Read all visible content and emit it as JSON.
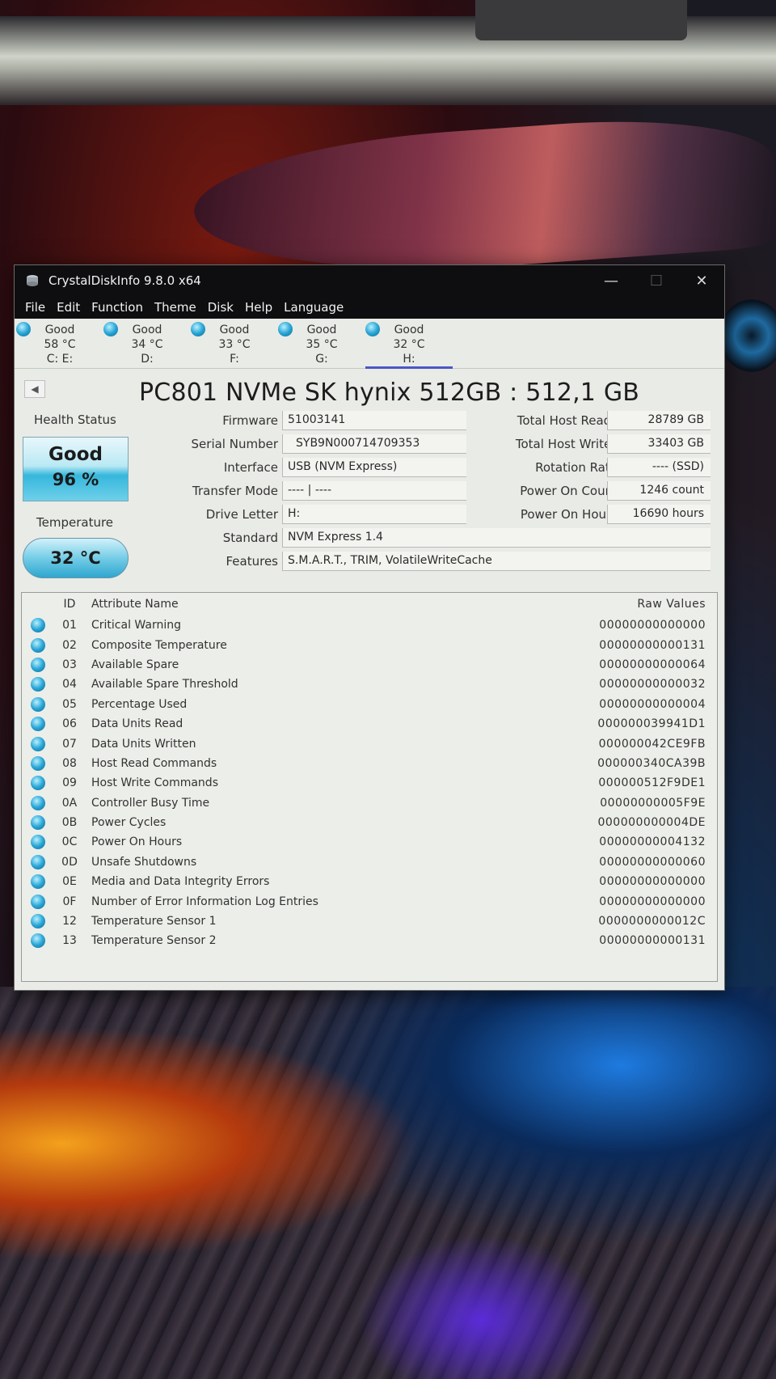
{
  "window": {
    "title": "CrystalDiskInfo 9.8.0 x64",
    "minimize": "—",
    "maximize": "☐",
    "close": "✕"
  },
  "menu": [
    "File",
    "Edit",
    "Function",
    "Theme",
    "Disk",
    "Help",
    "Language"
  ],
  "drives": [
    {
      "status": "Good",
      "temp": "58 °C",
      "letter": "C: E:"
    },
    {
      "status": "Good",
      "temp": "34 °C",
      "letter": "D:"
    },
    {
      "status": "Good",
      "temp": "33 °C",
      "letter": "F:"
    },
    {
      "status": "Good",
      "temp": "35 °C",
      "letter": "G:"
    },
    {
      "status": "Good",
      "temp": "32 °C",
      "letter": "H:"
    }
  ],
  "disk": {
    "title": "PC801 NVMe SK hynix 512GB : 512,1 GB",
    "prev_arrow": "◀"
  },
  "health": {
    "label": "Health Status",
    "status": "Good",
    "percent": "96 %",
    "temp_label": "Temperature",
    "temp": "32 °C"
  },
  "fields": {
    "firmware_label": "Firmware",
    "firmware": "51003141",
    "serial_label": "Serial Number",
    "serial": "SYB9N000714709353",
    "interface_label": "Interface",
    "interface": "USB (NVM Express)",
    "transfer_label": "Transfer Mode",
    "transfer": "---- | ----",
    "letter_label": "Drive Letter",
    "letter": "H:",
    "standard_label": "Standard",
    "standard": "NVM Express 1.4",
    "features_label": "Features",
    "features": "S.M.A.R.T., TRIM, VolatileWriteCache",
    "reads_label": "Total Host Reads",
    "reads": "28789 GB",
    "writes_label": "Total Host Writes",
    "writes": "33403 GB",
    "rotation_label": "Rotation Rate",
    "rotation": "---- (SSD)",
    "count_label": "Power On Count",
    "count": "1246 count",
    "hours_label": "Power On Hours",
    "hours": "16690 hours"
  },
  "smart": {
    "headers": {
      "id": "ID",
      "name": "Attribute Name",
      "raw": "Raw Values"
    },
    "rows": [
      {
        "id": "01",
        "name": "Critical Warning",
        "raw": "00000000000000"
      },
      {
        "id": "02",
        "name": "Composite Temperature",
        "raw": "00000000000131"
      },
      {
        "id": "03",
        "name": "Available Spare",
        "raw": "00000000000064"
      },
      {
        "id": "04",
        "name": "Available Spare Threshold",
        "raw": "00000000000032"
      },
      {
        "id": "05",
        "name": "Percentage Used",
        "raw": "00000000000004"
      },
      {
        "id": "06",
        "name": "Data Units Read",
        "raw": "000000039941D1"
      },
      {
        "id": "07",
        "name": "Data Units Written",
        "raw": "000000042CE9FB"
      },
      {
        "id": "08",
        "name": "Host Read Commands",
        "raw": "000000340CA39B"
      },
      {
        "id": "09",
        "name": "Host Write Commands",
        "raw": "000000512F9DE1"
      },
      {
        "id": "0A",
        "name": "Controller Busy Time",
        "raw": "00000000005F9E"
      },
      {
        "id": "0B",
        "name": "Power Cycles",
        "raw": "000000000004DE"
      },
      {
        "id": "0C",
        "name": "Power On Hours",
        "raw": "00000000004132"
      },
      {
        "id": "0D",
        "name": "Unsafe Shutdowns",
        "raw": "00000000000060"
      },
      {
        "id": "0E",
        "name": "Media and Data Integrity Errors",
        "raw": "00000000000000"
      },
      {
        "id": "0F",
        "name": "Number of Error Information Log Entries",
        "raw": "00000000000000"
      },
      {
        "id": "12",
        "name": "Temperature Sensor 1",
        "raw": "0000000000012C"
      },
      {
        "id": "13",
        "name": "Temperature Sensor 2",
        "raw": "00000000000131"
      }
    ]
  },
  "colors": {
    "good_status": "#2aa6d6",
    "titlebar": "#0e0e10",
    "window_bg": "#e9ebe6",
    "active_underline": "#4a56c8"
  }
}
